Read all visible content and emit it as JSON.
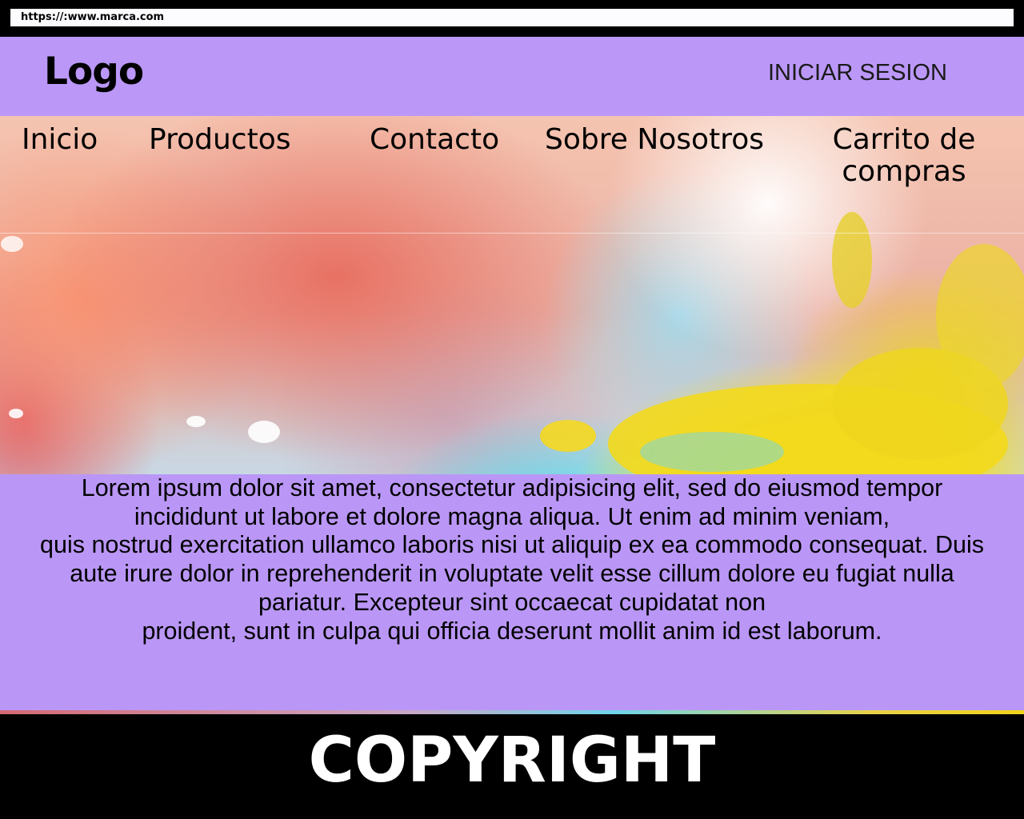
{
  "browser": {
    "url": "https://:www.marca.com"
  },
  "header": {
    "logo": "Logo",
    "login": "INICIAR SESION"
  },
  "nav": {
    "items": [
      {
        "label": "Inicio"
      },
      {
        "label": "Productos"
      },
      {
        "label": "Contacto"
      },
      {
        "label": "Sobre Nosotros"
      },
      {
        "label": "Carrito de compras"
      }
    ]
  },
  "content": {
    "lines": [
      "Lorem ipsum dolor sit amet, consectetur adipisicing elit, sed do eiusmod tempor incididunt ut labore et dolore magna aliqua. Ut enim ad minim veniam,",
      "quis nostrud exercitation ullamco laboris nisi ut aliquip ex ea commodo consequat. Duis aute irure dolor in reprehenderit in voluptate velit esse cillum dolore eu fugiat nulla pariatur. Excepteur sint occaecat cupidatat non",
      "proident, sunt in culpa qui officia deserunt mollit anim id est laborum."
    ]
  },
  "footer": {
    "copyright": "COPYRIGHT"
  },
  "colors": {
    "header": "#bb98f8",
    "content": "#ba97f6",
    "footer": "#000000"
  }
}
